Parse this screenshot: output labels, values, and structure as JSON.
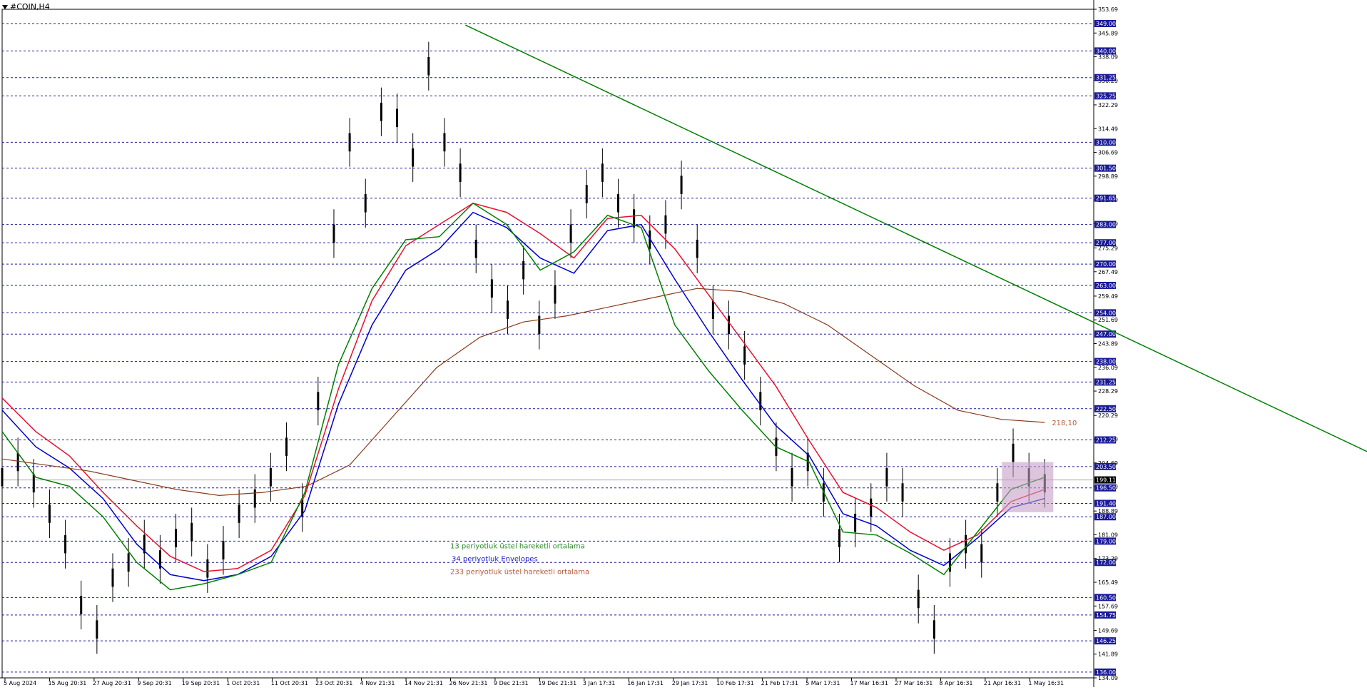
{
  "chart_data": {
    "type": "line",
    "title": "#COIN,H4",
    "x_labels": [
      "5 Aug 2024",
      "15 Aug 20:31",
      "27 Aug 20:31",
      "9 Sep 20:31",
      "19 Sep 20:31",
      "1 Oct 20:31",
      "11 Oct 20:31",
      "23 Oct 20:31",
      "4 Nov 21:31",
      "14 Nov 21:31",
      "26 Nov 21:31",
      "9 Dec 21:31",
      "19 Dec 21:31",
      "3 Jan 17:31",
      "16 Jan 17:31",
      "29 Jan 17:31",
      "10 Feb 17:31",
      "21 Feb 17:31",
      "5 Mar 17:31",
      "17 Mar 16:31",
      "27 Mar 16:31",
      "8 Apr 16:31",
      "21 Apr 16:31",
      "1 May 16:31"
    ],
    "y_ticks": [
      "353.69",
      "345.89",
      "338.09",
      "330.29",
      "322.29",
      "314.49",
      "306.69",
      "298.89",
      "291.09",
      "283.29",
      "275.29",
      "267.49",
      "259.49",
      "251.69",
      "243.89",
      "236.09",
      "228.29",
      "220.29",
      "212.49",
      "204.69",
      "196.89",
      "188.89",
      "181.09",
      "173.29",
      "165.49",
      "157.69",
      "149.69",
      "141.89",
      "134.09"
    ],
    "levels": [
      349.0,
      340.0,
      331.25,
      325.25,
      310.0,
      301.5,
      291.65,
      283.0,
      277.0,
      270.0,
      263.0,
      254.0,
      247.0,
      238.0,
      231.25,
      222.5,
      212.25,
      203.5,
      196.5,
      191.4,
      187.0,
      179.0,
      172.0,
      160.5,
      154.75,
      146.25,
      136.0
    ],
    "level_labels": [
      "349.00",
      "340.00",
      "331.25",
      "325.25",
      "310.00",
      "301.50",
      "291.65",
      "283.00",
      "277.00",
      "270.00",
      "263.00",
      "254.00",
      "247.00",
      "238.00",
      "231.25",
      "222.50",
      "212.25",
      "203.50",
      "196.50",
      "191.40",
      "187.00",
      "179.00",
      "172.00",
      "160.50",
      "154.75",
      "146.25",
      "136.00"
    ],
    "current_price": "199.11",
    "ylim": [
      134.09,
      353.69
    ],
    "series": [
      {
        "name": "13 periyotluk üstel hareketli ortalama",
        "color": "#008000",
        "values": [
          215,
          200,
          197,
          187,
          172,
          163,
          165,
          168,
          172,
          195,
          237,
          262,
          278,
          279,
          290,
          283,
          268,
          274,
          286,
          282,
          250,
          235,
          222,
          210,
          205,
          182,
          181,
          175,
          168,
          182,
          196,
          200
        ]
      },
      {
        "name": "34 periyotluk Envelopes",
        "color": "#0000cc",
        "values": [
          222,
          210,
          203,
          193,
          178,
          168,
          166,
          168,
          174,
          189,
          224,
          250,
          268,
          275,
          287,
          282,
          272,
          267,
          281,
          283,
          265,
          248,
          232,
          217,
          207,
          188,
          184,
          176,
          171,
          180,
          190,
          193
        ]
      },
      {
        "name": "233 periyotluk üstel hareketli ortalama",
        "color": "#8b3a1a",
        "values": [
          206,
          204,
          202,
          199,
          196,
          194,
          195,
          197,
          204,
          220,
          236,
          246,
          251,
          253,
          256,
          259,
          262,
          261,
          257,
          250,
          240,
          230,
          222,
          219,
          218
        ]
      }
    ],
    "red_line": [
      226,
      215,
      207,
      195,
      184,
      174,
      169,
      170,
      176,
      194,
      229,
      258,
      276,
      283,
      290,
      287,
      280,
      272,
      285,
      286,
      275,
      260,
      245,
      230,
      212,
      195,
      190,
      182,
      176,
      181,
      192,
      196
    ],
    "price_points": [
      200,
      205,
      198,
      188,
      178,
      158,
      150,
      167,
      172,
      178,
      173,
      180,
      182,
      170,
      176,
      188,
      193,
      200,
      210,
      190,
      225,
      280,
      310,
      290,
      320,
      318,
      305,
      335,
      310,
      300,
      275,
      262,
      255,
      268,
      250,
      260,
      280,
      293,
      300,
      290,
      285,
      278,
      283,
      296,
      275,
      255,
      250,
      240,
      225,
      210,
      200,
      205,
      195,
      180,
      185,
      190,
      200,
      195,
      160,
      150,
      172,
      178,
      175,
      195,
      208,
      200,
      198
    ],
    "trendline": {
      "from": [
        10.4,
        348.5
      ],
      "to": [
        32.5,
        195.5
      ],
      "color": "#008000"
    },
    "trendline_label": "218,10",
    "legend": [
      {
        "text": "13 periyotluk üstel hareketli ortalama",
        "color": "#2e8b2e"
      },
      {
        "text": "34 periyotluk Envelopes",
        "color": "#1a1acc"
      },
      {
        "text": "233 periyotluk üstel hareketli ortalama",
        "color": "#b35a3a"
      }
    ],
    "box": {
      "y_from": 188.5,
      "y_to": 205.0,
      "color": "#c7a0c7"
    },
    "grid": false,
    "legend_placement": "bottom-center"
  }
}
